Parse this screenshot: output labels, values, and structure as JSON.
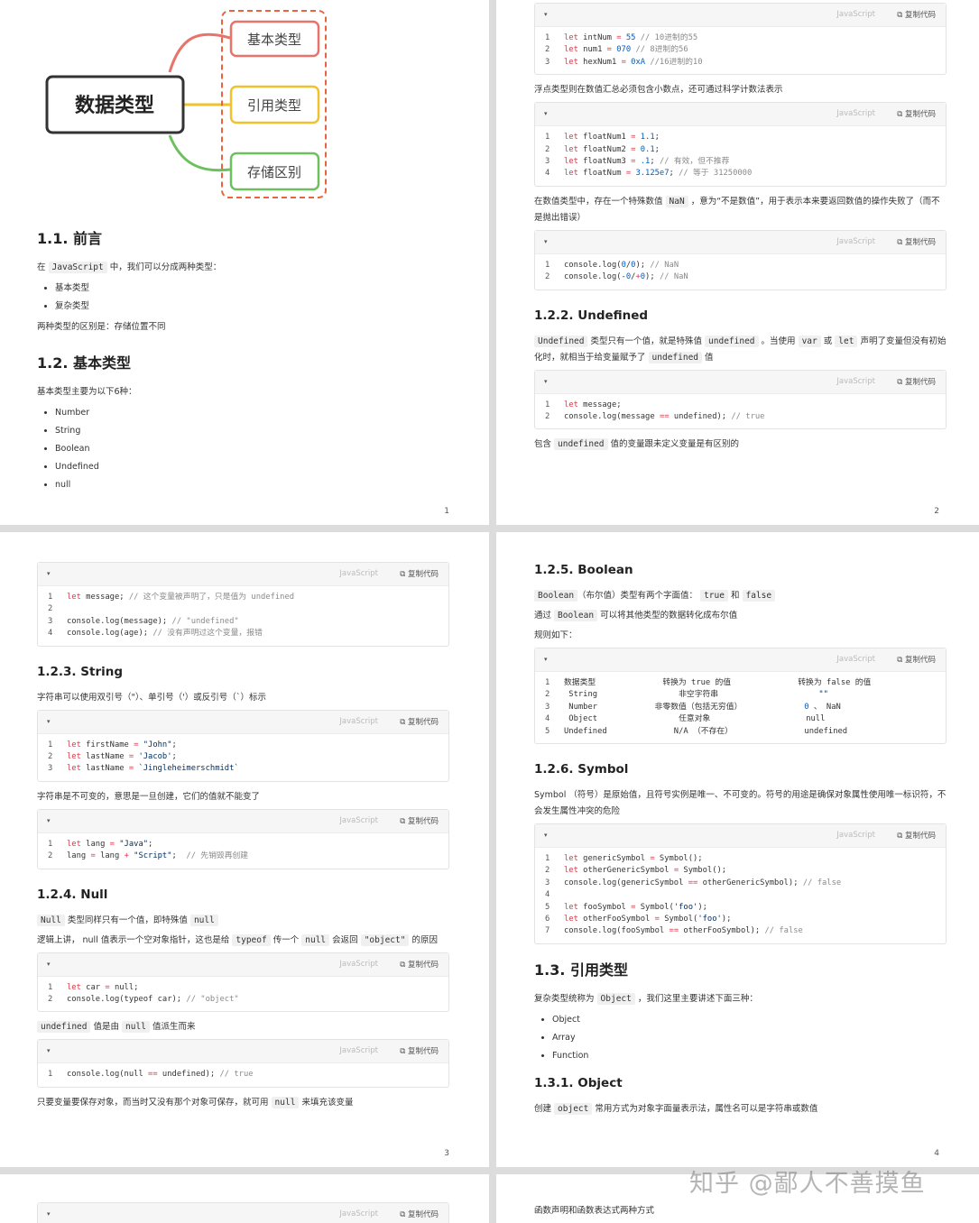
{
  "watermark": "知乎 @鄙人不善摸鱼",
  "ui": {
    "lang": "JavaScript",
    "copy": "复制代码",
    "caret": "▾"
  },
  "mindmap": {
    "root": "数据类型",
    "branches": [
      "基本类型",
      "引用类型",
      "存储区别"
    ],
    "colors": [
      "#e8736a",
      "#f2c12e",
      "#6cc05d"
    ]
  },
  "pages": [
    {
      "num": "1"
    },
    {
      "num": "2"
    },
    {
      "num": "3"
    },
    {
      "num": "4"
    }
  ],
  "p1": {
    "h_intro": "1.1. 前言",
    "intro_pre": "在 ",
    "intro_code": "JavaScript",
    "intro_post": " 中，我们可以分成两种类型：",
    "intro_list": [
      "基本类型",
      "复杂类型"
    ],
    "intro_diff": "两种类型的区别是：存储位置不同",
    "h_basic": "1.2. 基本类型",
    "basic_desc": "基本类型主要为以下6种：",
    "basic_list": [
      "Number",
      "String",
      "Boolean",
      "Undefined",
      "null"
    ]
  },
  "p2": {
    "code1": [
      [
        "1",
        "let intNum = 55 // 10进制的55"
      ],
      [
        "2",
        "let num1 = 070 // 8进制的56"
      ],
      [
        "3",
        "let hexNum1 = 0xA //16进制的10"
      ]
    ],
    "float_desc": "浮点类型则在数值汇总必须包含小数点，还可通过科学计数法表示",
    "code2": [
      [
        "1",
        "let floatNum1 = 1.1;"
      ],
      [
        "2",
        "let floatNum2 = 0.1;"
      ],
      [
        "3",
        "let floatNum3 = .1; // 有效，但不推荐"
      ],
      [
        "4",
        "let floatNum = 3.125e7; // 等于 31250000"
      ]
    ],
    "nan_pre": "在数值类型中，存在一个特殊数值 ",
    "nan_code": "NaN",
    "nan_post": " ，意为“不是数值”，用于表示本来要返回数值的操作失败了（而不是抛出错误）",
    "code3": [
      [
        "1",
        "console.log(0/0); // NaN"
      ],
      [
        "2",
        "console.log(-0/+0); // NaN"
      ]
    ],
    "h_undef": "1.2.2. Undefined",
    "undef_c1": "Undefined",
    "undef_t1": " 类型只有一个值，就是特殊值 ",
    "undef_c2": "undefined",
    "undef_t2": " 。当使用 ",
    "undef_c3": "var",
    "undef_t3": " 或 ",
    "undef_c4": "let",
    "undef_t4": " 声明了变量但没有初始化时，就相当于给变量赋予了 ",
    "undef_c5": "undefined",
    "undef_t5": " 值",
    "code4": [
      [
        "1",
        "let message;"
      ],
      [
        "2",
        "console.log(message == undefined); // true"
      ]
    ],
    "undef2_pre": "包含 ",
    "undef2_code": "undefined",
    "undef2_post": " 值的变量跟未定义变量是有区别的"
  },
  "p3": {
    "code1": [
      [
        "1",
        "let message; // 这个变量被声明了，只是值为 undefined"
      ],
      [
        "2",
        ""
      ],
      [
        "3",
        "console.log(message); // \"undefined\""
      ],
      [
        "4",
        "console.log(age); // 没有声明过这个变量，报错"
      ]
    ],
    "h_string": "1.2.3. String",
    "string_desc": "字符串可以使用双引号（\"）、单引号（'）或反引号（`）标示",
    "code2": [
      [
        "1",
        "let firstName = \"John\";"
      ],
      [
        "2",
        "let lastName = 'Jacob';"
      ],
      [
        "3",
        "let lastName = `Jingleheimerschmidt`"
      ]
    ],
    "string_immut": "字符串是不可变的，意思是一旦创建，它们的值就不能变了",
    "code3": [
      [
        "1",
        "let lang = \"Java\";"
      ],
      [
        "2",
        "lang = lang + \"Script\";  // 先销毁再创建"
      ]
    ],
    "h_null": "1.2.4. Null",
    "null_c1": "Null",
    "null_t1": " 类型同样只有一个值，即特殊值 ",
    "null_c2": "null",
    "null2_t1": "逻辑上讲， null 值表示一个空对象指针，这也是给 ",
    "null2_c1": "typeof",
    "null2_t2": " 传一个 ",
    "null2_c2": "null",
    "null2_t3": " 会返回 ",
    "null2_c3": "\"object\"",
    "null2_t4": " 的原因",
    "code4": [
      [
        "1",
        "let car = null;"
      ],
      [
        "2",
        "console.log(typeof car); // \"object\""
      ]
    ],
    "null3_c1": "undefined",
    "null3_t1": " 值是由 ",
    "null3_c2": "null",
    "null3_t2": " 值派生而来",
    "code5": [
      [
        "1",
        "console.log(null == undefined); // true"
      ]
    ],
    "null4_t1": "只要变量要保存对象，而当时又没有那个对象可保存，就可用 ",
    "null4_c1": "null",
    "null4_t2": " 来填充该变量"
  },
  "p4": {
    "h_bool": "1.2.5. Boolean",
    "bool_c1": "Boolean",
    "bool_t1": "（布尔值）类型有两个字面值： ",
    "bool_c2": "true",
    "bool_t2": " 和 ",
    "bool_c3": "false",
    "bool2_t1": "通过 ",
    "bool2_c1": "Boolean",
    "bool2_t2": " 可以将其他类型的数据转化成布尔值",
    "rules": "规则如下：",
    "code1": [
      [
        "1",
        "数据类型              转换为 true 的值              转换为 false 的值"
      ],
      [
        "2",
        " String                 非空字符串                     \"\""
      ],
      [
        "3",
        " Number            非零数值（包括无穷值）             0 、 NaN"
      ],
      [
        "4",
        " Object                 任意对象                    null"
      ],
      [
        "5",
        "Undefined              N/A （不存在）               undefined"
      ]
    ],
    "h_sym": "1.2.6. Symbol",
    "sym_desc": "Symbol （符号）是原始值，且符号实例是唯一、不可变的。符号的用途是确保对象属性使用唯一标识符，不会发生属性冲突的危险",
    "code2": [
      [
        "1",
        "let genericSymbol = Symbol();"
      ],
      [
        "2",
        "let otherGenericSymbol = Symbol();"
      ],
      [
        "3",
        "console.log(genericSymbol == otherGenericSymbol); // false"
      ],
      [
        "4",
        ""
      ],
      [
        "5",
        "let fooSymbol = Symbol('foo');"
      ],
      [
        "6",
        "let otherFooSymbol = Symbol('foo');"
      ],
      [
        "7",
        "console.log(fooSymbol == otherFooSymbol); // false"
      ]
    ],
    "h_ref": "1.3. 引用类型",
    "ref_t1": "复杂类型统称为 ",
    "ref_c1": "Object",
    "ref_t2": " ，我们这里主要讲述下面三种：",
    "ref_list": [
      "Object",
      "Array",
      "Function"
    ],
    "h_obj": "1.3.1. Object",
    "obj_t1": "创建 ",
    "obj_c1": "object",
    "obj_t2": " 常用方式为对象字面量表示法，属性名可以是字符串或数值"
  },
  "p6": {
    "text": "函数声明和函数表达式两种方式"
  }
}
